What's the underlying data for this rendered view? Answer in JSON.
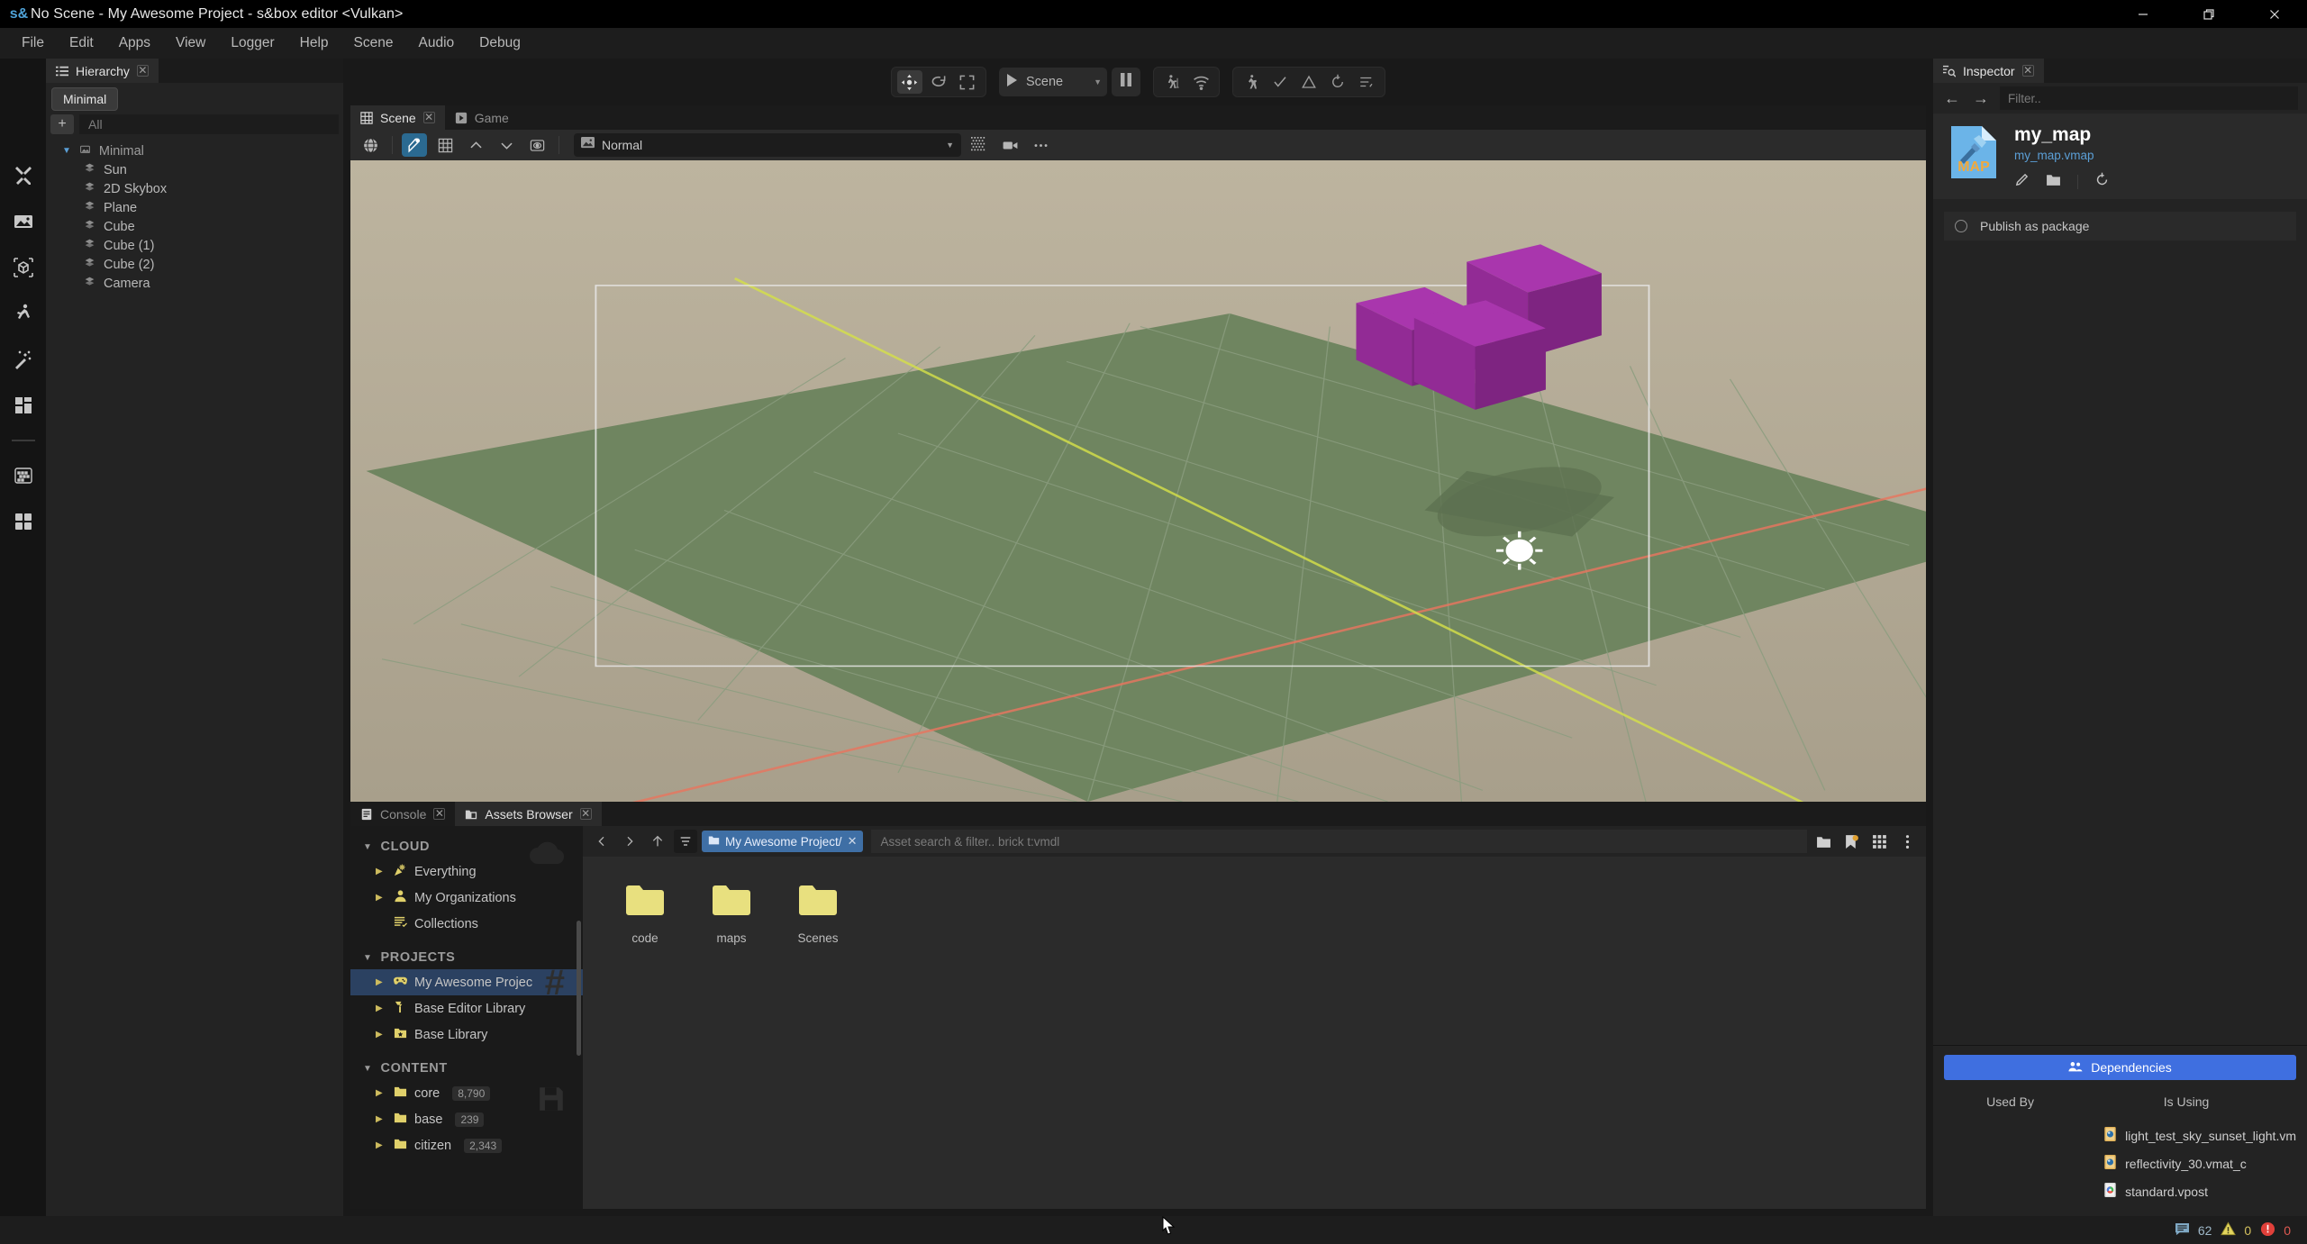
{
  "window": {
    "title": "No Scene - My Awesome Project - s&box editor <Vulkan>",
    "logo": "sbox-logo-icon",
    "controls": {
      "minimize": "—",
      "maximize": "❐",
      "close": "✕"
    }
  },
  "menubar": {
    "items": [
      "File",
      "Edit",
      "Apps",
      "View",
      "Logger",
      "Help",
      "Scene",
      "Audio",
      "Debug"
    ]
  },
  "rail": {
    "items": [
      {
        "name": "tools-icon"
      },
      {
        "name": "image-icon"
      },
      {
        "name": "model-icon"
      },
      {
        "name": "animation-icon"
      },
      {
        "name": "magic-wand-icon"
      },
      {
        "name": "layout-icon"
      },
      {
        "name": "divider"
      },
      {
        "name": "texture-icon"
      },
      {
        "name": "grid-icon"
      }
    ]
  },
  "main_toolbar": {
    "transform_tools": [
      "move-tool-icon",
      "rotate-tool-icon",
      "scale-tool-icon"
    ],
    "play_label": "Scene",
    "play_icon": "play-icon",
    "pause_icon": "pause-icon",
    "nav_group": [
      "walk-mode-icon",
      "network-icon"
    ],
    "status_group": [
      "run-icon",
      "check-icon",
      "warning-triangle-icon",
      "refresh-icon",
      "list-icon"
    ]
  },
  "hierarchy": {
    "tab_label": "Hierarchy",
    "tab_icon": "list-icon",
    "close_icon": "close-icon",
    "scene_tab": "Minimal",
    "add_button": "+",
    "filter_placeholder": "All",
    "tree": [
      {
        "label": "Minimal",
        "depth": 0,
        "icon": "scene-icon",
        "expanded": true
      },
      {
        "label": "Sun",
        "depth": 1,
        "icon": "object-icon"
      },
      {
        "label": "2D Skybox",
        "depth": 1,
        "icon": "object-icon"
      },
      {
        "label": "Plane",
        "depth": 1,
        "icon": "object-icon"
      },
      {
        "label": "Cube",
        "depth": 1,
        "icon": "object-icon"
      },
      {
        "label": "Cube (1)",
        "depth": 1,
        "icon": "object-icon"
      },
      {
        "label": "Cube (2)",
        "depth": 1,
        "icon": "object-icon"
      },
      {
        "label": "Camera",
        "depth": 1,
        "icon": "object-icon"
      }
    ]
  },
  "scene_view": {
    "tabs": [
      {
        "label": "Scene",
        "icon": "grid-icon",
        "active": true,
        "closable": true
      },
      {
        "label": "Game",
        "icon": "play-icon",
        "active": false,
        "closable": false
      }
    ],
    "toolbar": {
      "globe_icon": "globe-icon",
      "snap_icon": "snap-icon",
      "grid_icon": "grid-icon",
      "up_icon": "chevron-up-icon",
      "down_icon": "chevron-down-icon",
      "eye_icon": "visibility-icon",
      "render_mode": "Normal",
      "render_mode_icon": "image-icon",
      "dither_icon": "dither-icon",
      "camera_icon": "camera-icon",
      "more_icon": "ellipsis-icon"
    }
  },
  "bottom_dock": {
    "tabs": [
      {
        "label": "Console",
        "icon": "console-icon",
        "active": false,
        "closable": true
      },
      {
        "label": "Assets Browser",
        "icon": "folder-doc-icon",
        "active": true,
        "closable": true
      }
    ],
    "sidebar": {
      "sections": [
        {
          "title": "CLOUD",
          "watermark": "cloud-icon",
          "items": [
            {
              "label": "Everything",
              "icon": "party-icon",
              "arrow": true
            },
            {
              "label": "My Organizations",
              "icon": "person-icon",
              "arrow": true
            },
            {
              "label": "Collections",
              "icon": "collections-icon",
              "arrow": false
            }
          ]
        },
        {
          "title": "PROJECTS",
          "watermark": "hash-icon",
          "items": [
            {
              "label": "My Awesome Projec",
              "icon": "gamepad-icon",
              "arrow": true,
              "selected": true
            },
            {
              "label": "Base Editor Library",
              "icon": "editor-icon",
              "arrow": true
            },
            {
              "label": "Base Library",
              "icon": "star-folder-icon",
              "arrow": true
            }
          ]
        },
        {
          "title": "CONTENT",
          "watermark": "save-icon",
          "items": [
            {
              "label": "core",
              "icon": "folder-icon",
              "arrow": true,
              "count": "8,790"
            },
            {
              "label": "base",
              "icon": "folder-icon",
              "arrow": true,
              "count": "239"
            },
            {
              "label": "citizen",
              "icon": "folder-icon",
              "arrow": true,
              "count": "2,343"
            }
          ]
        }
      ]
    },
    "toolbar": {
      "back_icon": "chevron-left-icon",
      "forward_icon": "chevron-right-icon",
      "up_icon": "arrow-up-icon",
      "filter_icon": "filter-icon",
      "breadcrumb": "My Awesome Project/",
      "breadcrumb_close": "✕",
      "search_placeholder": "Asset search & filter.. brick t:vmdl",
      "right_icons": [
        "folder-icon",
        "bookmark-icon",
        "grid-view-icon",
        "more-vertical-icon"
      ]
    },
    "assets": [
      {
        "name": "code",
        "type": "folder"
      },
      {
        "name": "maps",
        "type": "folder"
      },
      {
        "name": "Scenes",
        "type": "folder"
      }
    ]
  },
  "inspector": {
    "tab_label": "Inspector",
    "tab_icon": "inspector-icon",
    "close_icon": "close-icon",
    "back_icon": "←",
    "forward_icon": "→",
    "filter_placeholder": "Filter..",
    "asset_icon": "map-file-icon",
    "asset_icon_label": "MAP",
    "title": "my_map",
    "subtitle": "my_map.vmap",
    "actions": [
      "edit-pencil-icon",
      "open-folder-icon",
      "refresh-icon"
    ],
    "publish_label": "Publish as package",
    "dependencies": {
      "button_label": "Dependencies",
      "button_icon": "people-icon",
      "button_color": "#3f6fe0",
      "columns": [
        {
          "header": "Used By",
          "items": []
        },
        {
          "header": "Is Using",
          "items": [
            {
              "label": "light_test_sky_sunset_light.vm",
              "icon": "material-icon"
            },
            {
              "label": "reflectivity_30.vmat_c",
              "icon": "material-icon"
            },
            {
              "label": "standard.vpost",
              "icon": "post-icon"
            }
          ]
        }
      ]
    }
  },
  "statusbar": {
    "items": [
      {
        "icon": "console-lines-icon",
        "value": "62",
        "color": "#9fb8c9"
      },
      {
        "icon": "warning-triangle-icon",
        "value": "0",
        "color": "#d4c15e"
      },
      {
        "icon": "error-circle-icon",
        "value": "0",
        "color": "#e05a52"
      }
    ]
  },
  "colors": {
    "accent_blue": "#3f6fe0",
    "selection_blue": "#2b4161",
    "ground_green": "#6f8560",
    "cube_purple": "#9c2fa0",
    "folder_yellow": "#e8e07f"
  }
}
